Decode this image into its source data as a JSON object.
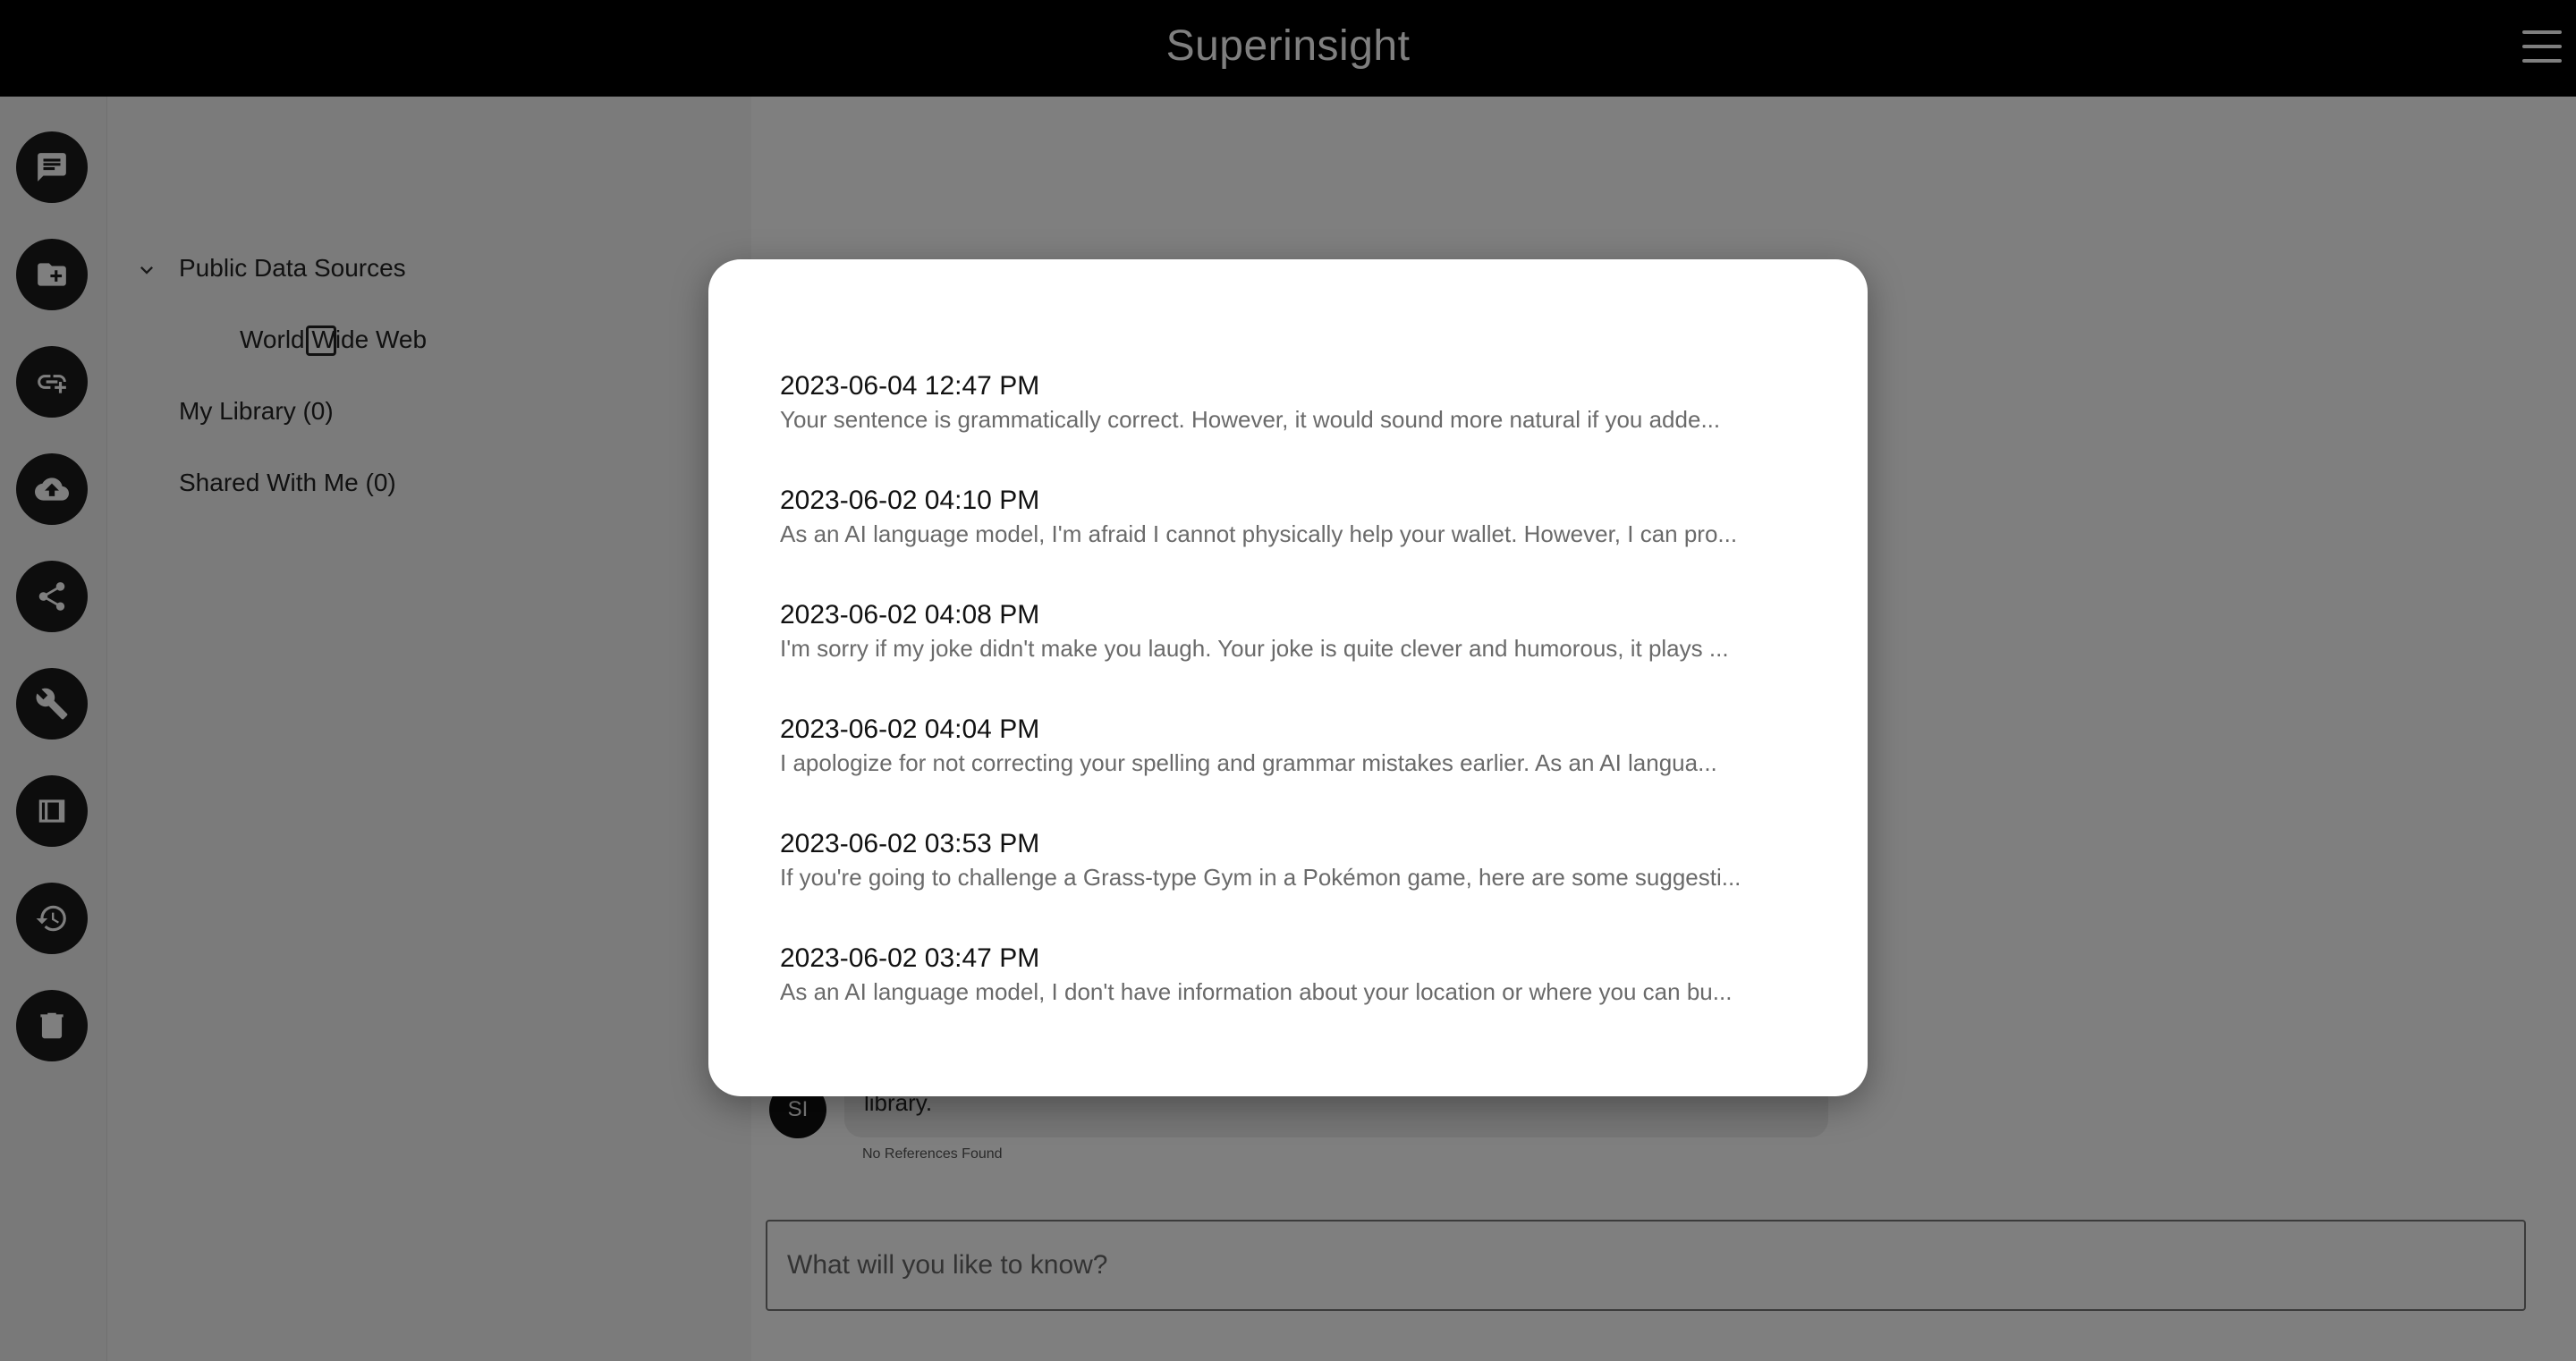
{
  "header": {
    "title": "Superinsight"
  },
  "rail": {
    "buttons": [
      "chat-icon",
      "folder-add-icon",
      "link-add-icon",
      "cloud-upload-icon",
      "share-icon",
      "wrench-icon",
      "film-icon",
      "history-icon",
      "trash-icon"
    ]
  },
  "sources": {
    "public_label": "Public Data Sources",
    "www_label": "World Wide Web",
    "library_label": "My Library (0)",
    "shared_label": "Shared With Me (0)"
  },
  "chat": {
    "avatar_initials": "SI",
    "message_fragment": "library.",
    "references": "No References Found",
    "input_placeholder": "What will you like to know?"
  },
  "history": {
    "items": [
      {
        "date": "2023-06-04 12:47 PM",
        "preview": "Your sentence is grammatically correct. However, it would sound more natural if you adde..."
      },
      {
        "date": "2023-06-02 04:10 PM",
        "preview": "As an AI language model, I'm afraid I cannot physically help your wallet. However, I can pro..."
      },
      {
        "date": "2023-06-02 04:08 PM",
        "preview": "I'm sorry if my joke didn't make you laugh. Your joke is quite clever and humorous, it plays ..."
      },
      {
        "date": "2023-06-02 04:04 PM",
        "preview": "I apologize for not correcting your spelling and grammar mistakes earlier. As an AI langua..."
      },
      {
        "date": "2023-06-02 03:53 PM",
        "preview": "If you're going to challenge a Grass-type Gym in a Pokémon game, here are some suggesti..."
      },
      {
        "date": "2023-06-02 03:47 PM",
        "preview": "As an AI language model, I don't have information about your location or where you can bu..."
      }
    ]
  }
}
